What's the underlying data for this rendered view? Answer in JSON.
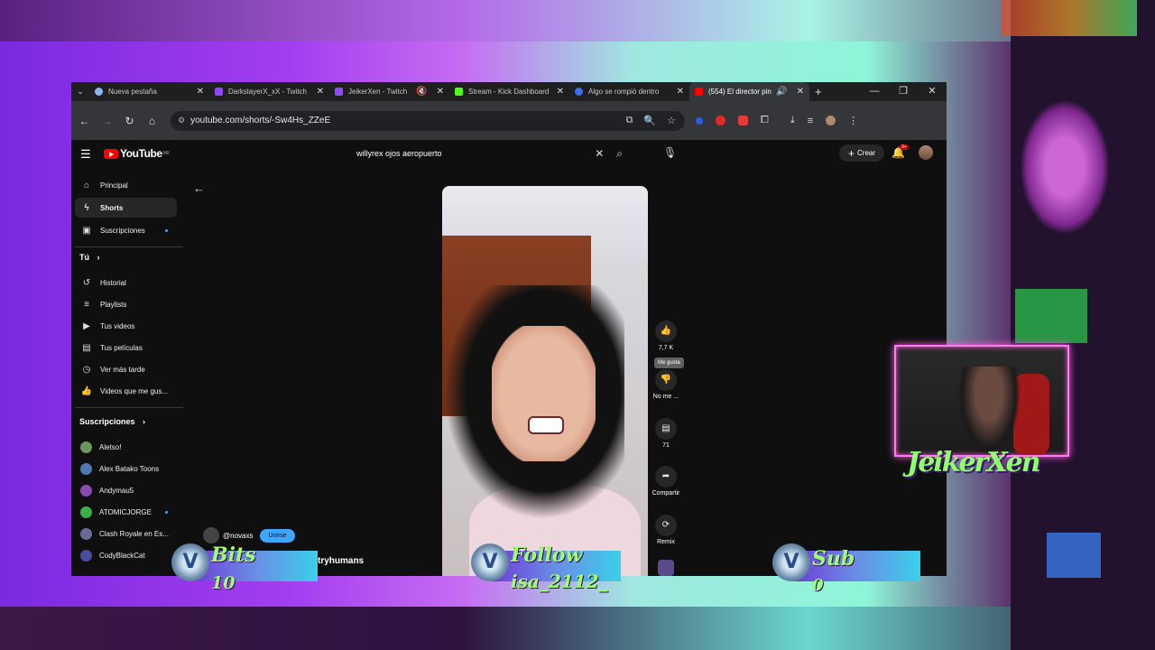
{
  "browser": {
    "tabs": [
      {
        "label": "Nueva pestaña",
        "icon": "chrome-icon",
        "color": "#8ab4f8"
      },
      {
        "label": "DarkslayerX_xX - Twitch",
        "icon": "twitch-icon",
        "color": "#9146ff"
      },
      {
        "label": "JeikerXen - Twitch",
        "icon": "twitch-icon",
        "color": "#9146ff"
      },
      {
        "label": "Stream - Kick Dashboard",
        "icon": "kick-icon",
        "color": "#53fc18"
      },
      {
        "label": "Algo se rompió dentro",
        "icon": "r-icon",
        "color": "#3b6df0"
      },
      {
        "label": "(554) El director pin",
        "icon": "youtube-icon",
        "color": "#ff0000"
      }
    ],
    "url": "youtube.com/shorts/-Sw4Hs_ZZeE"
  },
  "youtube": {
    "logo": "YouTube",
    "country": "MX",
    "search_query": "willyrex ojos aeropuerto",
    "create_label": "Crear",
    "notifications": "9+",
    "sidebar": {
      "main": [
        {
          "label": "Principal",
          "icon": "home-icon"
        },
        {
          "label": "Shorts",
          "icon": "shorts-icon"
        },
        {
          "label": "Suscripciones",
          "icon": "subscriptions-icon"
        }
      ],
      "you_header": "Tú",
      "you": [
        {
          "label": "Historial",
          "icon": "history-icon"
        },
        {
          "label": "Playlists",
          "icon": "playlist-icon"
        },
        {
          "label": "Tus videos",
          "icon": "video-icon"
        },
        {
          "label": "Tus películas",
          "icon": "film-icon"
        },
        {
          "label": "Ver más tarde",
          "icon": "clock-icon"
        },
        {
          "label": "Videos que me gus...",
          "icon": "like-icon"
        }
      ],
      "subs_header": "Suscripciones",
      "subs": [
        {
          "label": "Aletso!",
          "color": "#6a9a5a"
        },
        {
          "label": "Alex Batako Toons",
          "color": "#4a7ab0"
        },
        {
          "label": "Andymau5",
          "color": "#8a4ab0"
        },
        {
          "label": "ATOMICJORGE",
          "color": "#3ab04a"
        },
        {
          "label": "Clash Royale en Es...",
          "color": "#6a6a9a"
        },
        {
          "label": "CodyBlackCat",
          "color": "#4a4aa0"
        }
      ]
    },
    "actions": {
      "like_count": "7,7 K",
      "like_tooltip": "Me gusta",
      "dislike_label": "No me ...",
      "comments": "71",
      "share": "Compartir",
      "remix": "Remix"
    },
    "channel": {
      "handle": "@novaxs",
      "join": "Unirse"
    },
    "video_title_partial": "tryhumans"
  },
  "overlay": {
    "bits_label": "Bits",
    "bits_value": "10",
    "follow_label": "Follow",
    "follow_value": "isa_2112_",
    "sub_label": "Sub",
    "sub_value": "0",
    "streamer_name": "JeikerXen",
    "badge_letter": "V"
  }
}
